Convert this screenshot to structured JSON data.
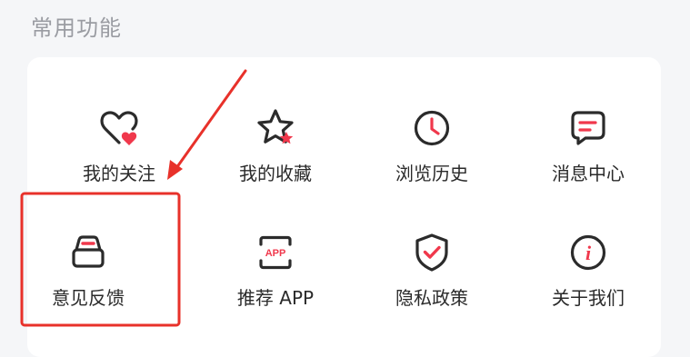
{
  "section": {
    "title": "常用功能"
  },
  "features": [
    {
      "label": "我的关注",
      "icon": "heart-icon"
    },
    {
      "label": "我的收藏",
      "icon": "star-icon"
    },
    {
      "label": "浏览历史",
      "icon": "clock-icon"
    },
    {
      "label": "消息中心",
      "icon": "message-icon"
    },
    {
      "label": "意见反馈",
      "icon": "feedback-inbox-icon"
    },
    {
      "label": "推荐 APP",
      "icon": "recommend-app-icon",
      "badge": "APP"
    },
    {
      "label": "隐私政策",
      "icon": "shield-check-icon"
    },
    {
      "label": "关于我们",
      "icon": "info-icon",
      "glyph": "i"
    }
  ],
  "colors": {
    "accent": "#f0384c",
    "icon_stroke": "#2b2b2b",
    "annotation": "#e8312a"
  },
  "annotation": {
    "highlighted_item": "意见反馈"
  }
}
